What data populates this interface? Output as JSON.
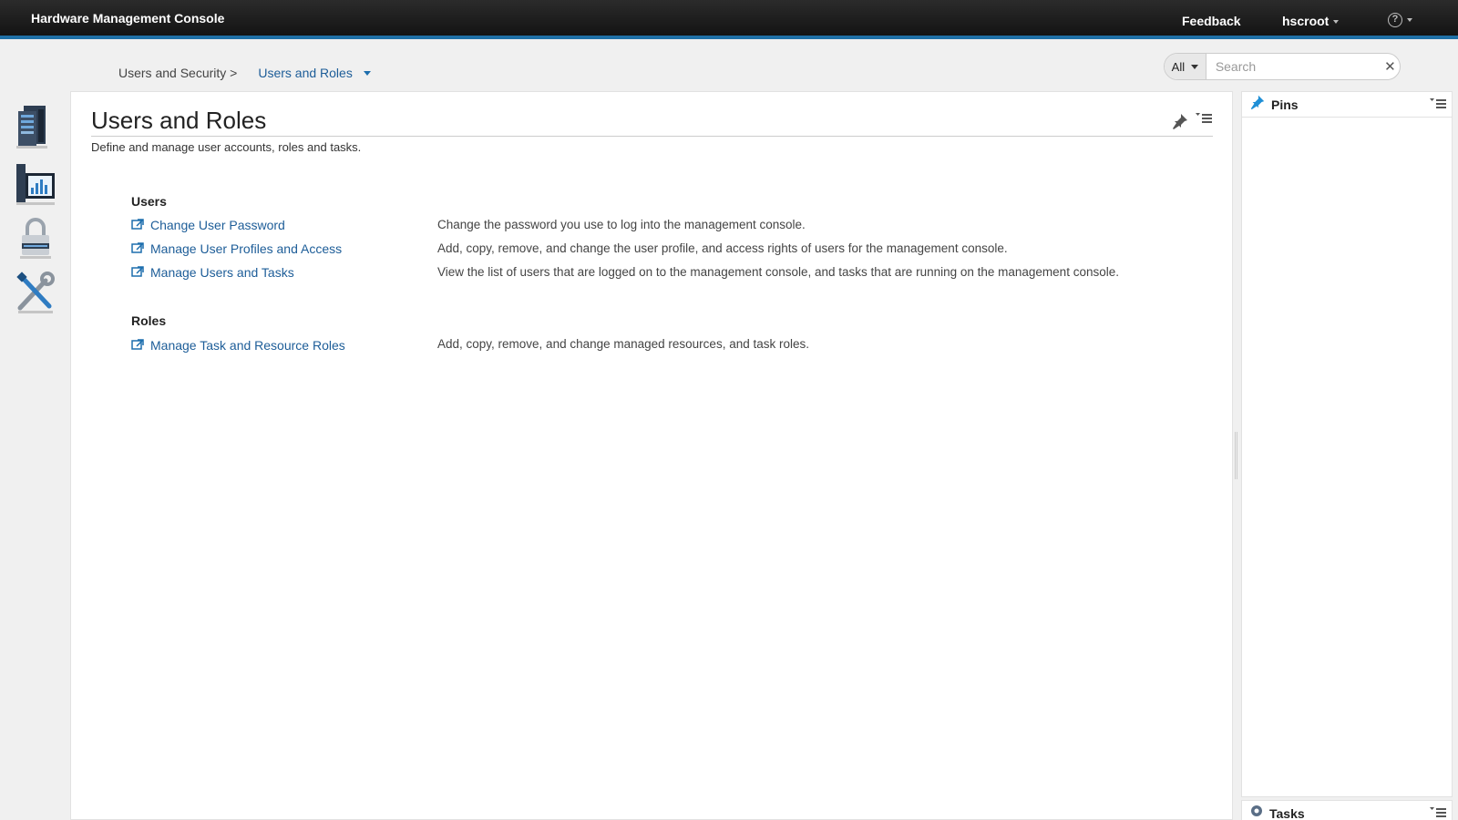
{
  "header": {
    "app_title": "Hardware Management Console",
    "feedback_label": "Feedback",
    "user_label": "hscroot",
    "accent_color": "#1f70a6"
  },
  "breadcrumb": {
    "parent": "Users and Security >",
    "current": "Users and Roles"
  },
  "search": {
    "scope": "All",
    "placeholder": "Search",
    "value": ""
  },
  "left_nav": {
    "items": [
      {
        "icon": "server-icon"
      },
      {
        "icon": "monitor-chart-icon"
      },
      {
        "icon": "padlock-icon"
      },
      {
        "icon": "tools-icon"
      }
    ]
  },
  "main": {
    "title": "Users and Roles",
    "description": "Define and manage user accounts, roles and tasks.",
    "sections": [
      {
        "heading": "Users",
        "tasks": [
          {
            "label": "Change User Password",
            "description": "Change the password you use to log into the management console."
          },
          {
            "label": "Manage User Profiles and Access",
            "description": "Add, copy, remove, and change the user profile, and access rights of users for the management console."
          },
          {
            "label": "Manage Users and Tasks",
            "description": "View the list of users that are logged on to the management console, and tasks that are running on the management console."
          }
        ]
      },
      {
        "heading": "Roles",
        "tasks": [
          {
            "label": "Manage Task and Resource Roles",
            "description": "Add, copy, remove, and change managed resources, and task roles."
          }
        ]
      }
    ]
  },
  "side_panels": {
    "pins_title": "Pins",
    "tasks_title": "Tasks"
  },
  "colors": {
    "link": "#1d5d98",
    "pin_icon": "#1f8fd6"
  }
}
